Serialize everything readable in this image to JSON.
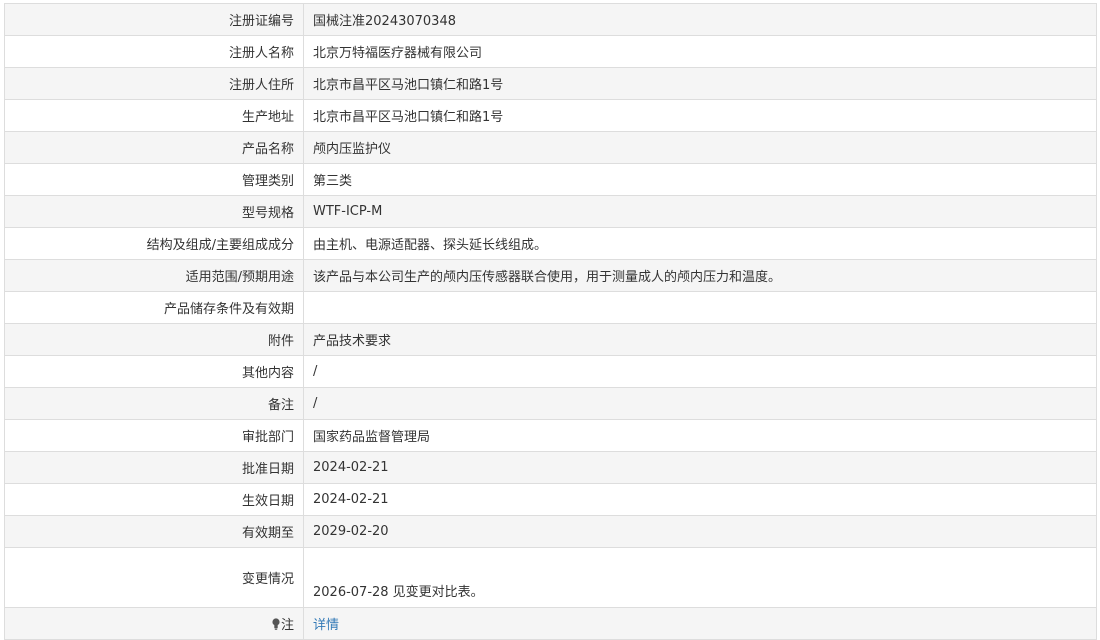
{
  "rows": [
    {
      "label": "注册证编号",
      "value": "国械注准20243070348"
    },
    {
      "label": "注册人名称",
      "value": "北京万特福医疗器械有限公司"
    },
    {
      "label": "注册人住所",
      "value": "北京市昌平区马池口镇仁和路1号"
    },
    {
      "label": "生产地址",
      "value": "北京市昌平区马池口镇仁和路1号"
    },
    {
      "label": "产品名称",
      "value": "颅内压监护仪"
    },
    {
      "label": "管理类别",
      "value": "第三类"
    },
    {
      "label": "型号规格",
      "value": "WTF-ICP-M"
    },
    {
      "label": "结构及组成/主要组成成分",
      "value": "由主机、电源适配器、探头延长线组成。"
    },
    {
      "label": "适用范围/预期用途",
      "value": "该产品与本公司生产的颅内压传感器联合使用，用于测量成人的颅内压力和温度。"
    },
    {
      "label": "产品储存条件及有效期",
      "value": ""
    },
    {
      "label": "附件",
      "value": "产品技术要求"
    },
    {
      "label": "其他内容",
      "value": "/"
    },
    {
      "label": "备注",
      "value": "/"
    },
    {
      "label": "审批部门",
      "value": "国家药品监督管理局"
    },
    {
      "label": "批准日期",
      "value": "2024-02-21"
    },
    {
      "label": "生效日期",
      "value": "2024-02-21"
    },
    {
      "label": "有效期至",
      "value": "2029-02-20"
    },
    {
      "label": "变更情况",
      "value": "2026-07-28 见变更对比表。"
    }
  ],
  "note": {
    "label": "注",
    "icon": "lightbulb-icon",
    "link_text": "详情",
    "link_color": "#337ab7"
  },
  "colors": {
    "border": "#dddddd",
    "alt_row_bg": "#f5f5f5",
    "text": "#333333"
  }
}
